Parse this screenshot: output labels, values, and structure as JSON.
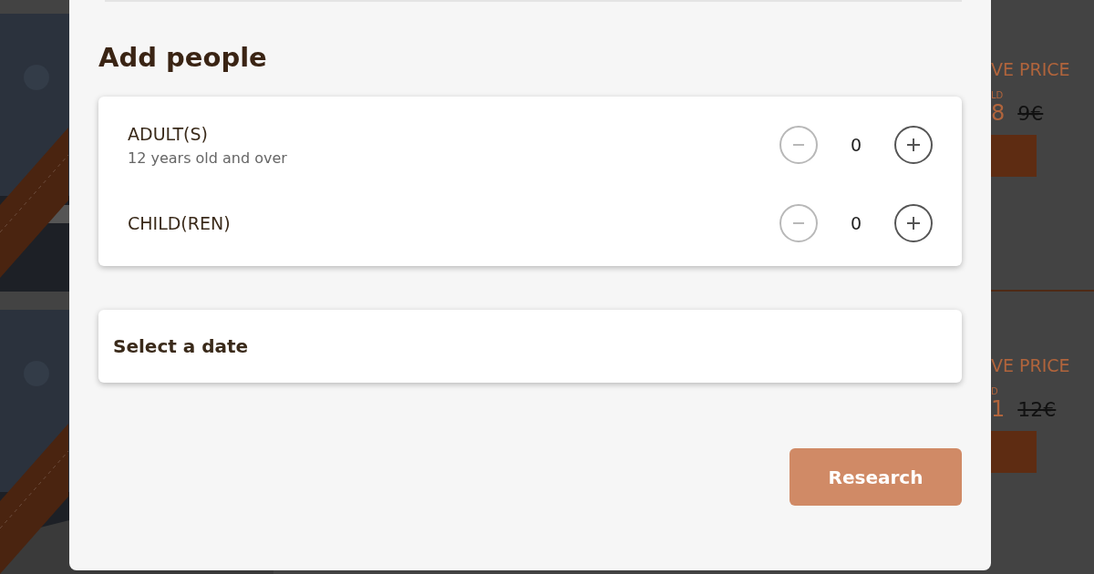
{
  "background_cards": [
    {
      "price_label": "VE PRICE",
      "small_label": "LD",
      "price": "8",
      "old_price": "9€"
    },
    {
      "price_label": "VE PRICE",
      "small_label": "D",
      "price": "1",
      "old_price": "12€"
    }
  ],
  "modal": {
    "title": "Add people",
    "counters": [
      {
        "label": "ADULT(S)",
        "note": "12 years old and over",
        "value": "0",
        "minus_disabled": true,
        "plus_disabled": false
      },
      {
        "label": "CHILD(REN)",
        "value": "0",
        "minus_disabled": true,
        "plus_disabled": false
      }
    ],
    "date_field": {
      "placeholder": "Select a date"
    },
    "submit": "Research"
  }
}
